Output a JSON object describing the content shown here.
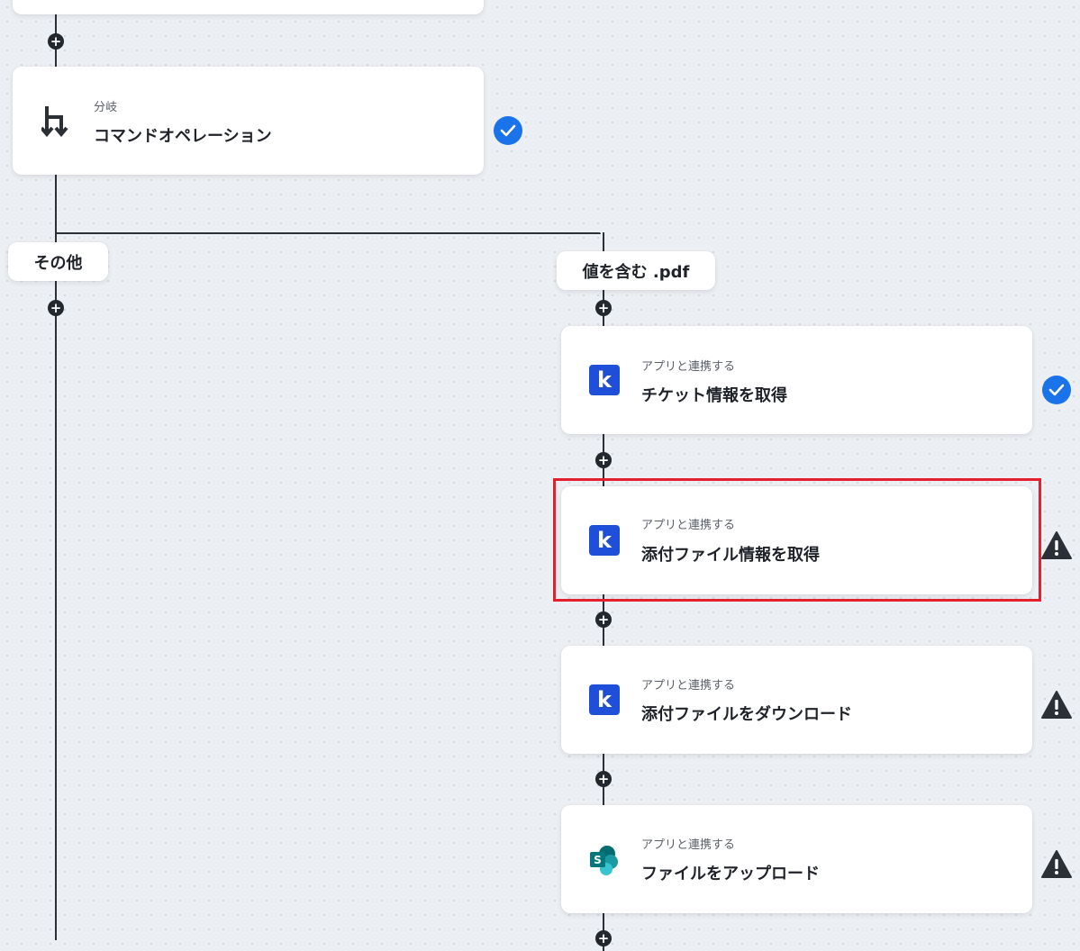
{
  "flow": {
    "branch_step": {
      "label": "分岐",
      "title": "コマンドオペレーション",
      "icon": "branch-icon",
      "status": "complete"
    },
    "branches": {
      "left_label": "その他",
      "right_label": "値を含む .pdf"
    },
    "steps": [
      {
        "label": "アプリと連携する",
        "title": "チケット情報を取得",
        "icon": "kintone-icon",
        "icon_glyph": "k",
        "status": "complete"
      },
      {
        "label": "アプリと連携する",
        "title": "添付ファイル情報を取得",
        "icon": "kintone-icon",
        "icon_glyph": "k",
        "status": "warning",
        "highlighted": true
      },
      {
        "label": "アプリと連携する",
        "title": "添付ファイルをダウンロード",
        "icon": "kintone-icon",
        "icon_glyph": "k",
        "status": "warning"
      },
      {
        "label": "アプリと連携する",
        "title": "ファイルをアップロード",
        "icon": "sharepoint-icon",
        "icon_glyph": "S",
        "status": "warning"
      }
    ],
    "add_step_glyph": "+",
    "colors": {
      "check": "#1a73e8",
      "warning": "#2b2f36",
      "highlight": "#e3202f",
      "kintone": "#1f4fd8",
      "sharepoint": "#0b7a75"
    }
  }
}
